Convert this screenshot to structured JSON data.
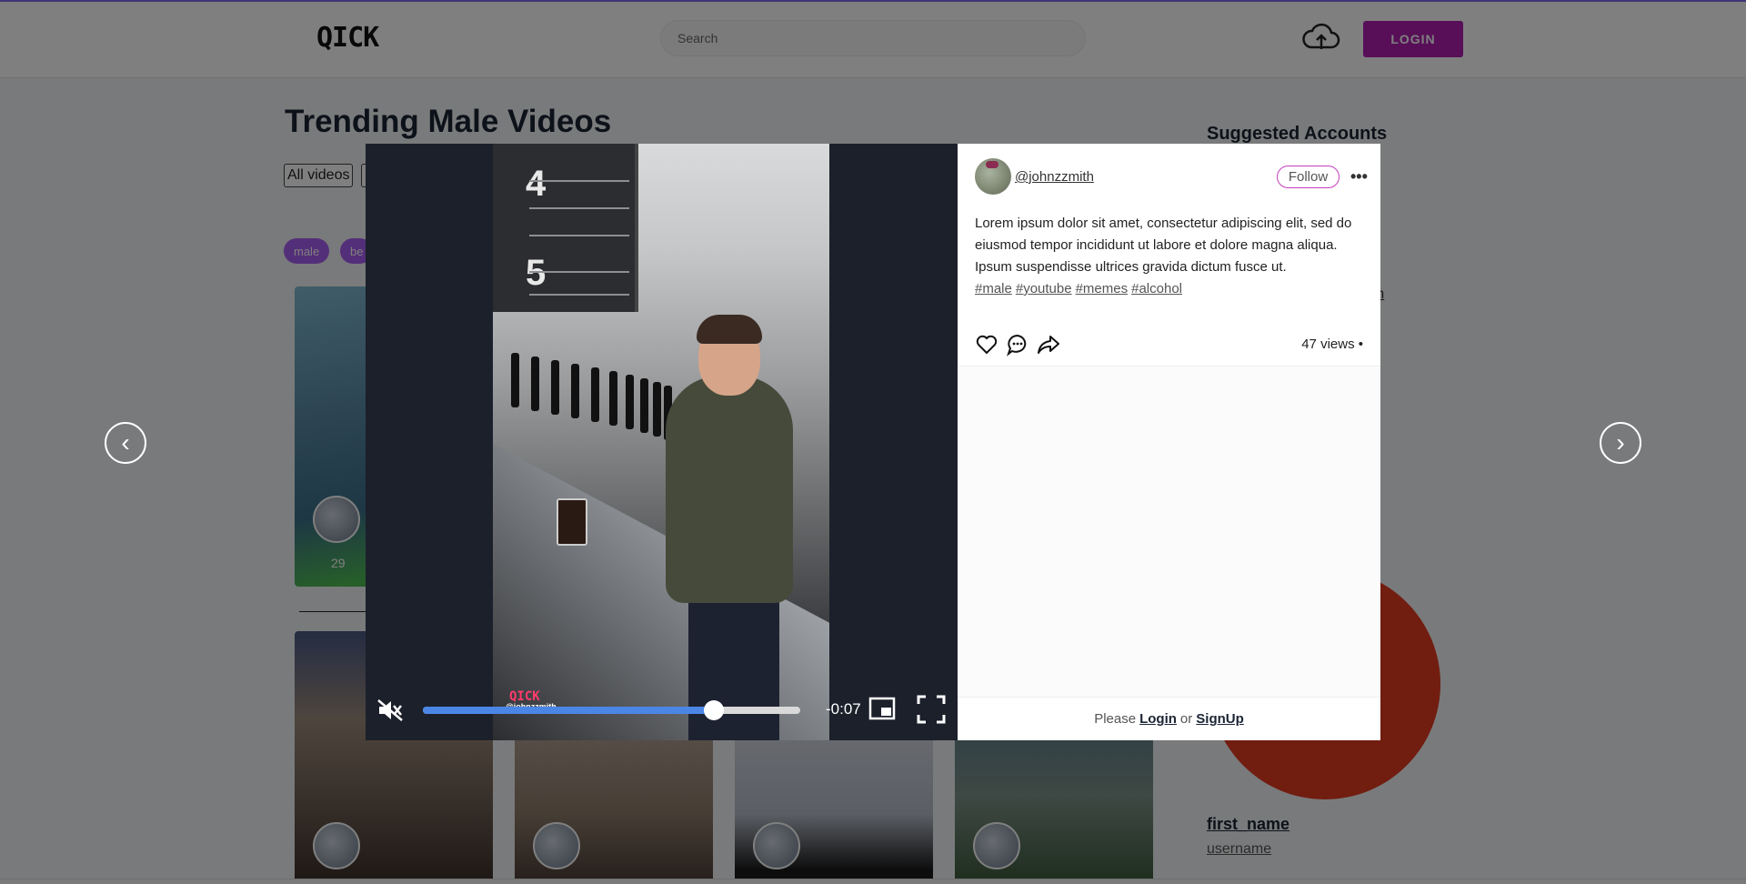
{
  "header": {
    "logo": "QICK",
    "search_placeholder": "Search",
    "login_label": "LOGIN",
    "upload_icon": "cloud-upload-icon"
  },
  "page": {
    "title": "Trending Male Videos",
    "filters": [
      "All videos"
    ],
    "tags": [
      "male",
      "be"
    ],
    "thumb_count": "29"
  },
  "sidebar": {
    "title": "Suggested Accounts",
    "partial_link": "om",
    "profile": {
      "first_name": "first_name",
      "username": "username"
    }
  },
  "modal": {
    "author": "@johnzzmith",
    "follow_label": "Follow",
    "more_label": "•••",
    "description": "Lorem ipsum dolor sit amet, consectetur adipiscing elit, sed do eiusmod tempor incididunt ut labore et dolore magna aliqua. Ipsum suspendisse ultrices gravida dictum fusce ut.",
    "hashtags": [
      "#male",
      "#youtube",
      "#memes",
      "#alcohol"
    ],
    "views": "47 views •",
    "footer": {
      "prefix": "Please",
      "login": "Login",
      "or": "or",
      "signup": "SignUp"
    },
    "video": {
      "time_remaining": "-0:07",
      "progress_fraction": 0.77,
      "watermark_logo": "QICK",
      "watermark_handle": "@johnzzmith",
      "board_numbers": [
        "4",
        "5"
      ]
    },
    "nav": {
      "prev": "‹",
      "next": "›"
    }
  },
  "colors": {
    "accent": "#b01fb0",
    "progress": "#4b86e6",
    "tag": "#a95ef2"
  }
}
